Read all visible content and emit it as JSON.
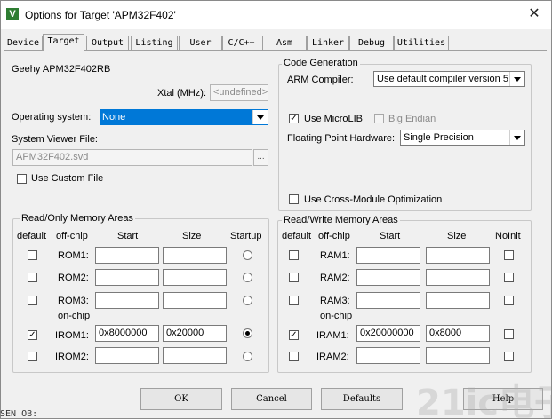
{
  "window": {
    "title": "Options for Target 'APM32F402'",
    "close_glyph": "✕"
  },
  "tabs": [
    {
      "label": "Device"
    },
    {
      "label": "Target"
    },
    {
      "label": "Output"
    },
    {
      "label": "Listing"
    },
    {
      "label": "User"
    },
    {
      "label": "C/C++"
    },
    {
      "label": "Asm"
    },
    {
      "label": "Linker"
    },
    {
      "label": "Debug"
    },
    {
      "label": "Utilities"
    }
  ],
  "target": {
    "device_name": "Geehy APM32F402RB",
    "xtal_label": "Xtal (MHz):",
    "xtal_value": "<undefined>",
    "os_label": "Operating system:",
    "os_value": "None",
    "svd_label": "System Viewer File:",
    "svd_value": "APM32F402.svd",
    "svd_browse": "...",
    "custom_file_label": "Use Custom File"
  },
  "codegen": {
    "title": "Code Generation",
    "compiler_label": "ARM Compiler:",
    "compiler_value": "Use default compiler version 5",
    "microlib_label": "Use MicroLIB",
    "big_endian_label": "Big Endian",
    "fpu_label": "Floating Point Hardware:",
    "fpu_value": "Single Precision",
    "cross_module_label": "Use Cross-Module Optimization"
  },
  "ro_memory": {
    "title": "Read/Only Memory Areas",
    "headers": {
      "default": "default",
      "offchip": "off-chip",
      "start": "Start",
      "size": "Size",
      "startup": "Startup"
    },
    "onchip_label": "on-chip",
    "rows": [
      {
        "name": "ROM1:",
        "start": "",
        "size": ""
      },
      {
        "name": "ROM2:",
        "start": "",
        "size": ""
      },
      {
        "name": "ROM3:",
        "start": "",
        "size": ""
      },
      {
        "name": "IROM1:",
        "start": "0x8000000",
        "size": "0x20000"
      },
      {
        "name": "IROM2:",
        "start": "",
        "size": ""
      }
    ]
  },
  "rw_memory": {
    "title": "Read/Write Memory Areas",
    "headers": {
      "default": "default",
      "offchip": "off-chip",
      "start": "Start",
      "size": "Size",
      "noinit": "NoInit"
    },
    "onchip_label": "on-chip",
    "rows": [
      {
        "name": "RAM1:",
        "start": "",
        "size": ""
      },
      {
        "name": "RAM2:",
        "start": "",
        "size": ""
      },
      {
        "name": "RAM3:",
        "start": "",
        "size": ""
      },
      {
        "name": "IRAM1:",
        "start": "0x20000000",
        "size": "0x8000"
      },
      {
        "name": "IRAM2:",
        "start": "",
        "size": ""
      }
    ]
  },
  "buttons": {
    "ok": "OK",
    "cancel": "Cancel",
    "defaults": "Defaults",
    "help": "Help"
  },
  "check_glyph": "✓",
  "watermark": "21ic电子网",
  "background_text": "SEN OB:"
}
